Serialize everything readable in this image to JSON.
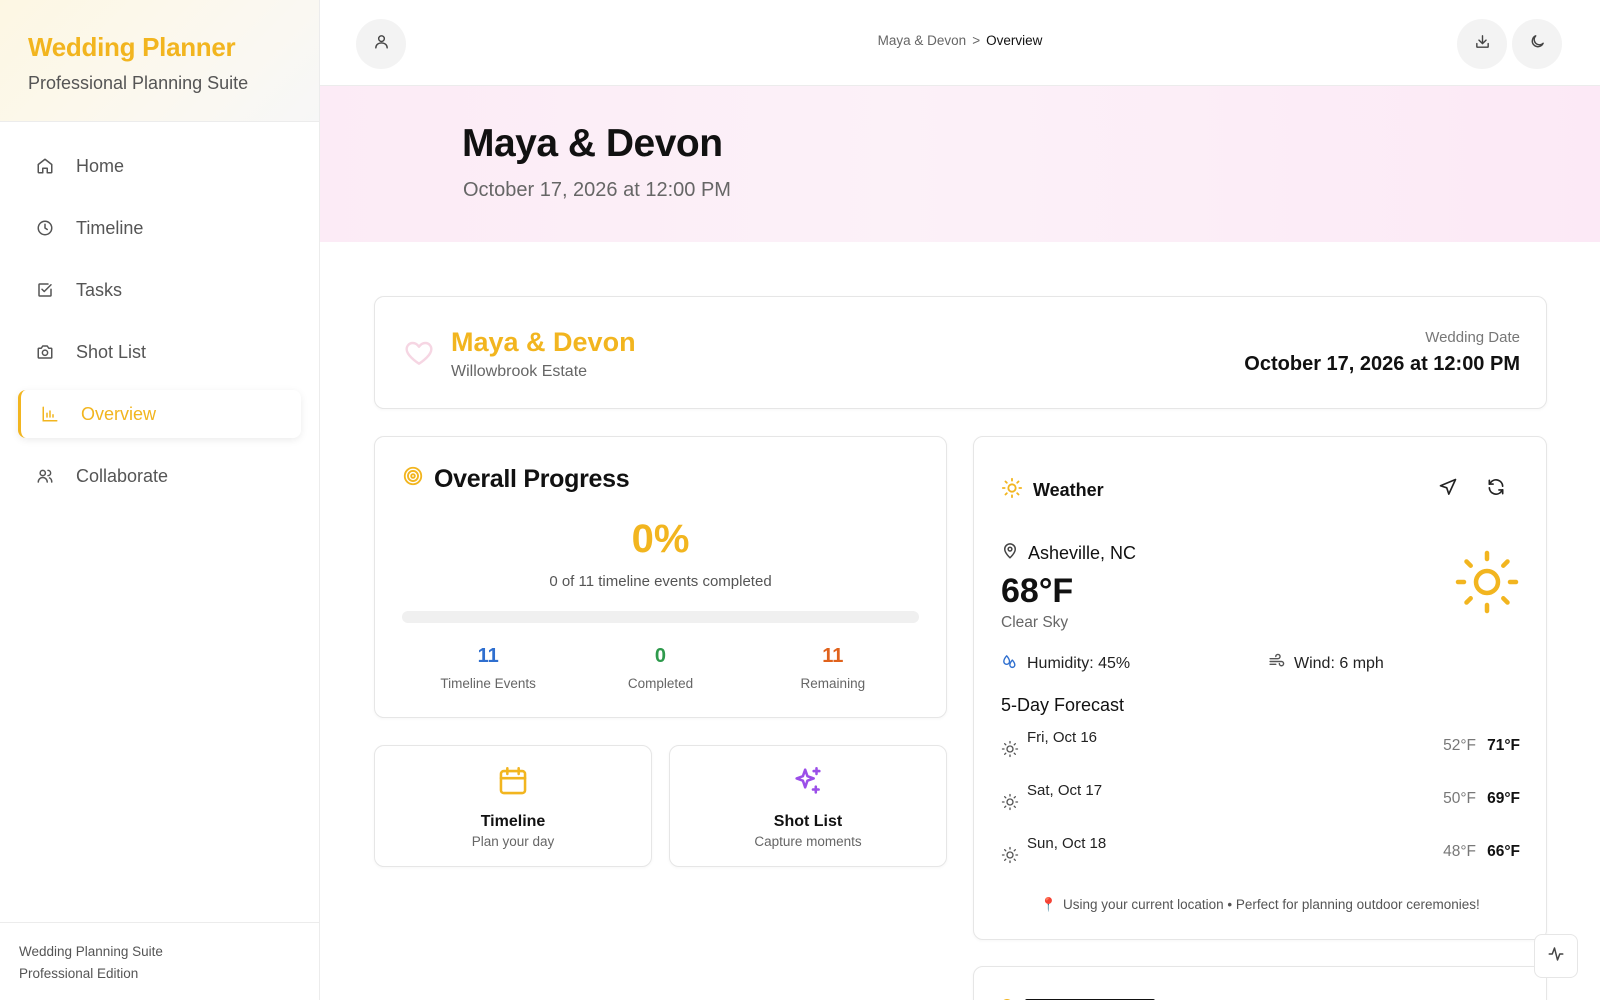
{
  "brand": {
    "title": "Wedding Planner",
    "subtitle": "Professional Planning Suite"
  },
  "sidebar": {
    "items": [
      {
        "label": "Home",
        "icon": "home-icon"
      },
      {
        "label": "Timeline",
        "icon": "clock-icon"
      },
      {
        "label": "Tasks",
        "icon": "checkbox-icon"
      },
      {
        "label": "Shot List",
        "icon": "camera-icon"
      },
      {
        "label": "Overview",
        "icon": "bar-chart-icon",
        "active": true
      },
      {
        "label": "Collaborate",
        "icon": "users-icon"
      }
    ],
    "footer": {
      "line1": "Wedding Planning Suite",
      "line2": "Professional Edition"
    }
  },
  "topbar": {
    "breadcrumb": {
      "parent": "Maya & Devon",
      "separator": ">",
      "current": "Overview"
    },
    "icons": {
      "profile": "user-icon",
      "download": "download-icon",
      "theme": "moon-icon"
    }
  },
  "hero": {
    "title": "Maya & Devon",
    "date": "October 17, 2026 at 12:00 PM"
  },
  "couple_card": {
    "names": "Maya & Devon",
    "venue": "Willowbrook Estate",
    "date_label": "Wedding Date",
    "date_value": "October 17, 2026 at 12:00 PM"
  },
  "progress": {
    "title": "Overall Progress",
    "percent_text": "0%",
    "percent": 0,
    "summary": "0 of 11 timeline events completed",
    "stats": [
      {
        "value": "11",
        "label": "Timeline Events",
        "color": "#2f6fcf"
      },
      {
        "value": "0",
        "label": "Completed",
        "color": "#2e9a4c"
      },
      {
        "value": "11",
        "label": "Remaining",
        "color": "#e0621c"
      }
    ]
  },
  "quick_links": [
    {
      "title": "Timeline",
      "subtitle": "Plan your day",
      "icon": "calendar-icon"
    },
    {
      "title": "Shot List",
      "subtitle": "Capture moments",
      "icon": "sparkles-icon"
    }
  ],
  "weather": {
    "title": "Weather",
    "location": "Asheville, NC",
    "temperature": "68°F",
    "condition": "Clear Sky",
    "humidity": "Humidity: 45%",
    "wind": "Wind: 6 mph",
    "forecast_title": "5-Day Forecast",
    "forecast": [
      {
        "day": "Fri, Oct 16",
        "low": "52°F",
        "high": "71°F"
      },
      {
        "day": "Sat, Oct 17",
        "low": "50°F",
        "high": "69°F"
      },
      {
        "day": "Sun, Oct 18",
        "low": "48°F",
        "high": "66°F"
      }
    ],
    "note_pin": "📍",
    "note": "Using your current location • Perfect for planning outdoor ceremonies!"
  },
  "colors": {
    "accent": "#f2b51f",
    "hero_pink": "#fcebf6",
    "sparkle_purple": "#9b4ee8"
  }
}
